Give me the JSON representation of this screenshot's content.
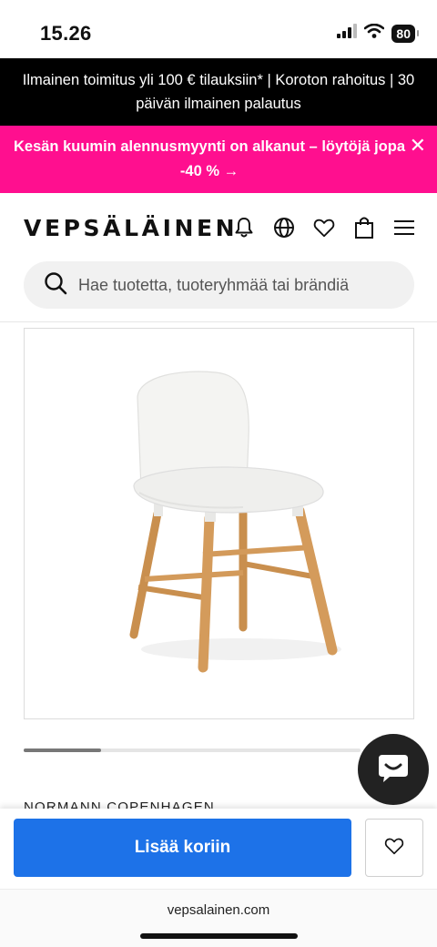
{
  "status_bar": {
    "time": "15.26",
    "battery": "80"
  },
  "promo_bars": {
    "info": "Ilmainen toimitus yli 100 € tilauksiin* | Koroton rahoitus | 30 päivän ilmainen palautus",
    "sale": "Kesän kuumin alennusmyynti on alkanut – löytöjä jopa -40 % →",
    "close_symbol": "✕"
  },
  "header": {
    "logo": "VEPSÄLÄINEN",
    "icons": [
      "bell-icon",
      "globe-icon",
      "heart-icon",
      "shopping-bag-icon",
      "menu-icon"
    ]
  },
  "search": {
    "placeholder": "Hae tuotetta, tuoteryhmää tai brändiä"
  },
  "product": {
    "brand_partial": "NORMANN COPENHAGEN",
    "gallery_progress": 0.23
  },
  "actions": {
    "add_to_cart": "Lisää koriin"
  },
  "browser": {
    "url": "vepsalainen.com"
  },
  "colors": {
    "sale_pink": "#ff0f8f",
    "cta_blue": "#1d72e8",
    "chat_dark": "#222222"
  }
}
